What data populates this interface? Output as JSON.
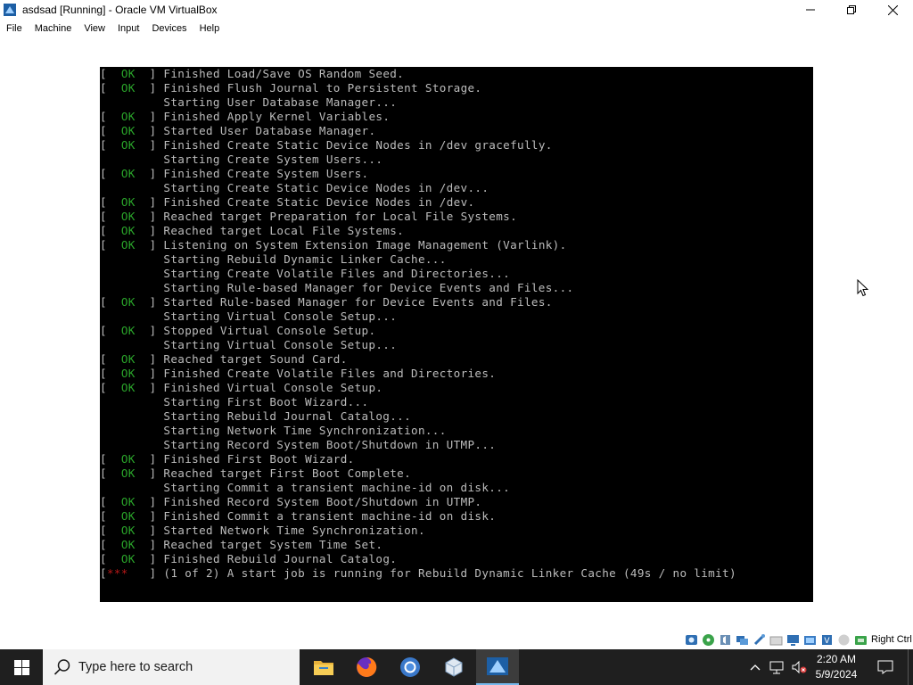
{
  "window": {
    "title": "asdsad [Running] - Oracle VM VirtualBox"
  },
  "menu": [
    "File",
    "Machine",
    "View",
    "Input",
    "Devices",
    "Help"
  ],
  "console": {
    "lines": [
      {
        "status": "OK",
        "text": "Finished Load/Save OS Random Seed."
      },
      {
        "status": "OK",
        "text": "Finished Flush Journal to Persistent Storage."
      },
      {
        "status": "",
        "text": "Starting User Database Manager..."
      },
      {
        "status": "OK",
        "text": "Finished Apply Kernel Variables."
      },
      {
        "status": "OK",
        "text": "Started User Database Manager."
      },
      {
        "status": "OK",
        "text": "Finished Create Static Device Nodes in /dev gracefully."
      },
      {
        "status": "",
        "text": "Starting Create System Users..."
      },
      {
        "status": "OK",
        "text": "Finished Create System Users."
      },
      {
        "status": "",
        "text": "Starting Create Static Device Nodes in /dev..."
      },
      {
        "status": "OK",
        "text": "Finished Create Static Device Nodes in /dev."
      },
      {
        "status": "OK",
        "text": "Reached target Preparation for Local File Systems."
      },
      {
        "status": "OK",
        "text": "Reached target Local File Systems."
      },
      {
        "status": "OK",
        "text": "Listening on System Extension Image Management (Varlink)."
      },
      {
        "status": "",
        "text": "Starting Rebuild Dynamic Linker Cache..."
      },
      {
        "status": "",
        "text": "Starting Create Volatile Files and Directories..."
      },
      {
        "status": "",
        "text": "Starting Rule-based Manager for Device Events and Files..."
      },
      {
        "status": "OK",
        "text": "Started Rule-based Manager for Device Events and Files."
      },
      {
        "status": "",
        "text": "Starting Virtual Console Setup..."
      },
      {
        "status": "OK",
        "text": "Stopped Virtual Console Setup."
      },
      {
        "status": "",
        "text": "Starting Virtual Console Setup..."
      },
      {
        "status": "OK",
        "text": "Reached target Sound Card."
      },
      {
        "status": "OK",
        "text": "Finished Create Volatile Files and Directories."
      },
      {
        "status": "OK",
        "text": "Finished Virtual Console Setup."
      },
      {
        "status": "",
        "text": "Starting First Boot Wizard..."
      },
      {
        "status": "",
        "text": "Starting Rebuild Journal Catalog..."
      },
      {
        "status": "",
        "text": "Starting Network Time Synchronization..."
      },
      {
        "status": "",
        "text": "Starting Record System Boot/Shutdown in UTMP..."
      },
      {
        "status": "OK",
        "text": "Finished First Boot Wizard."
      },
      {
        "status": "OK",
        "text": "Reached target First Boot Complete."
      },
      {
        "status": "",
        "text": "Starting Commit a transient machine-id on disk..."
      },
      {
        "status": "OK",
        "text": "Finished Record System Boot/Shutdown in UTMP."
      },
      {
        "status": "OK",
        "text": "Finished Commit a transient machine-id on disk."
      },
      {
        "status": "OK",
        "text": "Started Network Time Synchronization."
      },
      {
        "status": "OK",
        "text": "Reached target System Time Set."
      },
      {
        "status": "OK",
        "text": "Finished Rebuild Journal Catalog."
      },
      {
        "status": "***",
        "text": "(1 of 2) A start job is running for Rebuild Dynamic Linker Cache (49s / no limit)"
      }
    ]
  },
  "statusbar": {
    "host_key": "Right Ctrl",
    "icons": [
      "hard-disk-icon",
      "optical-drive-icon",
      "audio-icon",
      "network-icon",
      "usb-icon",
      "shared-folders-icon",
      "display-icon",
      "video-capture-icon",
      "cpu-icon",
      "mouse-integration-icon",
      "keyboard-icon"
    ]
  },
  "taskbar": {
    "search_placeholder": "Type here to search",
    "apps": [
      "file-explorer-icon",
      "firefox-icon",
      "chrome-icon",
      "virtualbox-manager-icon",
      "virtualbox-vm-icon"
    ],
    "time": "2:20 AM",
    "date": "5/9/2024"
  },
  "colors": {
    "ok": "#2aa52a",
    "stars": "#b81818",
    "console_text": "#bcbcbc",
    "taskbar": "#1f1f1f"
  }
}
